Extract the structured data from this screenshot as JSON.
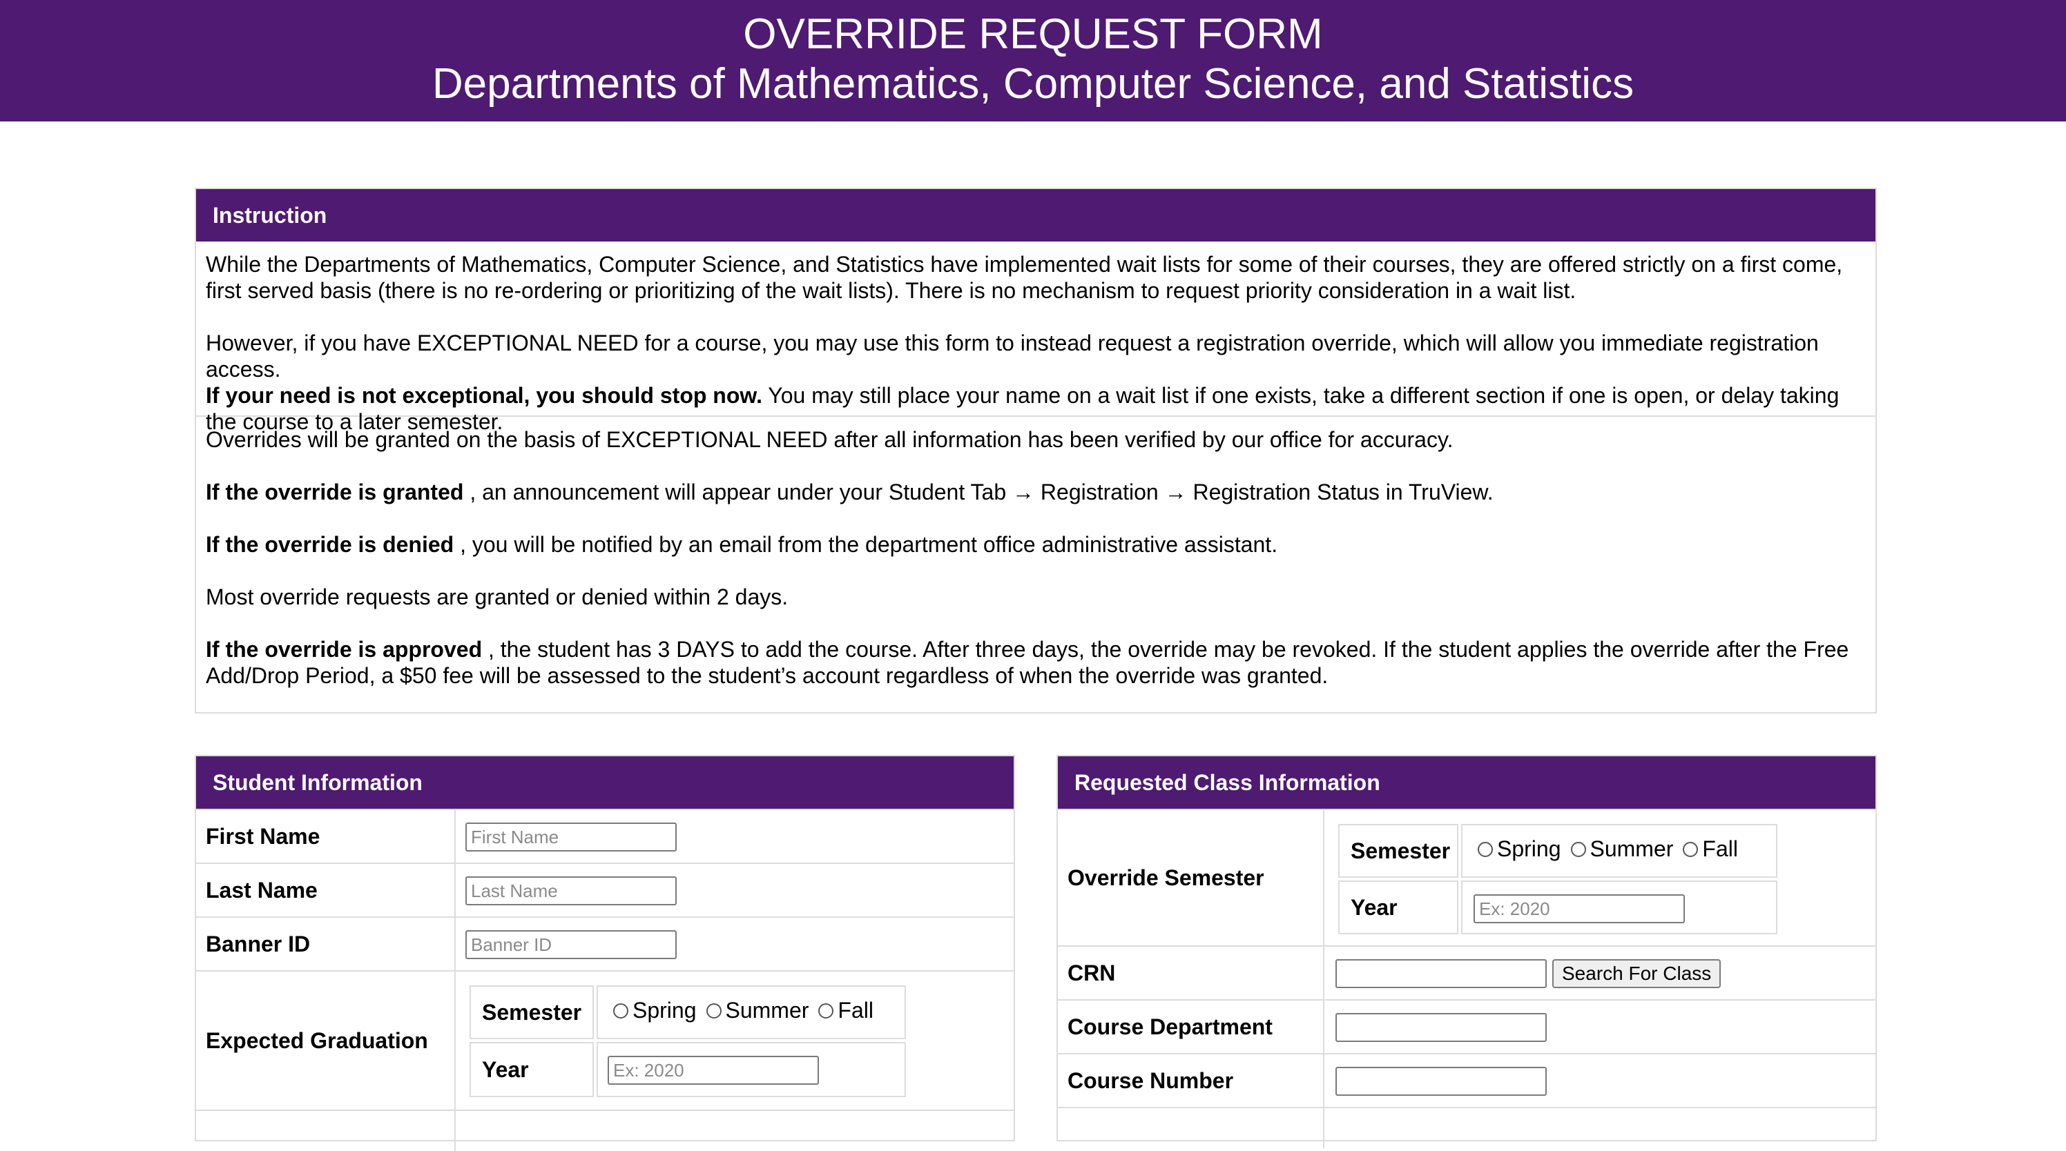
{
  "header": {
    "title": "OVERRIDE REQUEST FORM",
    "subtitle": "Departments of Mathematics, Computer Science, and Statistics"
  },
  "instruction": {
    "heading": "Instruction",
    "p1": "While the Departments of Mathematics, Computer Science, and Statistics have implemented wait lists for some of their courses, they are offered strictly on a first come, first served basis (there is no re-ordering or prioritizing of the wait lists). There is no mechanism to request priority consideration in a wait list.",
    "p2": "However, if you have EXCEPTIONAL NEED for a course, you may use this form to instead request a registration override, which will allow you immediate registration access.",
    "p2_bold": "If your need is not exceptional, you should stop now.",
    "p2_rest": " You may still place your name on a wait list if one exists, take a different section if one is open, or delay taking the course to a later semester.",
    "p3": "Overrides will be granted on the basis of EXCEPTIONAL NEED after all information has been verified by our office for accuracy.",
    "p4_bold": "If the override is granted",
    "p4_rest": " , an announcement will appear under your Student Tab → Registration → Registration Status in TruView.",
    "p5_bold": "If the override is denied",
    "p5_rest": " , you will be notified by an email from the department office administrative assistant.",
    "p6": "Most override requests are granted or denied within 2 days.",
    "p7_bold": "If the override is approved",
    "p7_rest": " , the student has 3 DAYS to add the course. After three days, the override may be revoked. If the student applies the override after the Free Add/Drop Period, a $50 fee will be assessed to the student’s account regardless of when the override was granted."
  },
  "student": {
    "heading": "Student Information",
    "first_name_label": "First Name",
    "first_name_placeholder": "First Name",
    "last_name_label": "Last Name",
    "last_name_placeholder": "Last Name",
    "banner_label": "Banner ID",
    "banner_placeholder": "Banner ID",
    "grad_label": "Expected Graduation",
    "semester_label": "Semester",
    "year_label": "Year",
    "year_placeholder": "Ex: 2020",
    "semester_options": [
      "Spring",
      "Summer",
      "Fall"
    ]
  },
  "class_info": {
    "heading": "Requested Class Information",
    "override_semester_label": "Override Semester",
    "semester_label": "Semester",
    "year_label": "Year",
    "year_placeholder": "Ex: 2020",
    "semester_options": [
      "Spring",
      "Summer",
      "Fall"
    ],
    "crn_label": "CRN",
    "search_button": "Search For Class",
    "department_label": "Course Department",
    "number_label": "Course Number"
  }
}
